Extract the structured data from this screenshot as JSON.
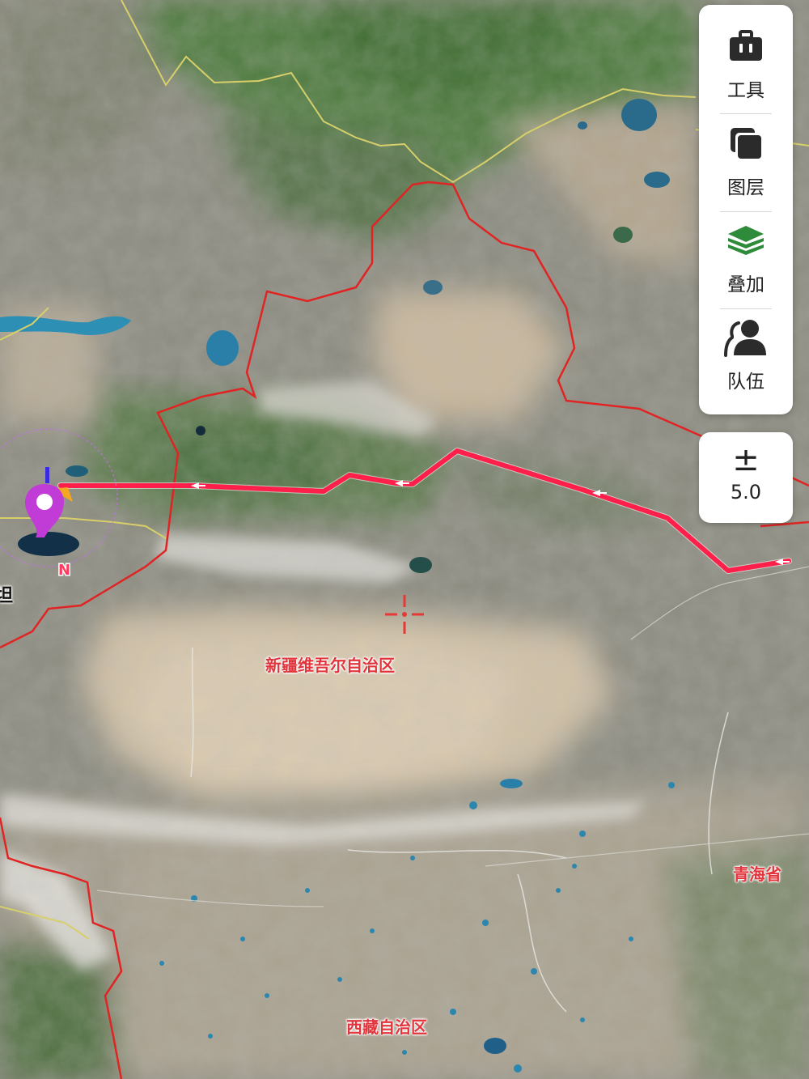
{
  "map": {
    "type": "satellite",
    "region_labels": [
      {
        "id": "xinjiang",
        "text": "新疆维吾尔自治区"
      },
      {
        "id": "qinghai",
        "text": "青海省"
      },
      {
        "id": "xizang",
        "text": "西藏自治区"
      }
    ],
    "edge_label": {
      "text": "坦"
    },
    "north_indicator": "N",
    "route": {
      "color": "#ff1f4b",
      "direction": "westbound"
    },
    "colors": {
      "route": "#ff1f4b",
      "border": "#e02424",
      "intl_border": "#d8cf6a",
      "marker": "#c13bd6",
      "crosshair": "#e53935"
    }
  },
  "toolbar": {
    "items": [
      {
        "id": "tools",
        "label": "工具",
        "icon": "toolbox-icon"
      },
      {
        "id": "layers",
        "label": "图层",
        "icon": "layers-copy-icon"
      },
      {
        "id": "overlay",
        "label": "叠加",
        "icon": "stack-overlay-icon",
        "icon_color": "#2e8b3a"
      },
      {
        "id": "team",
        "label": "队伍",
        "icon": "team-icon"
      }
    ]
  },
  "zoom": {
    "symbol": "±",
    "level": "5.0"
  }
}
